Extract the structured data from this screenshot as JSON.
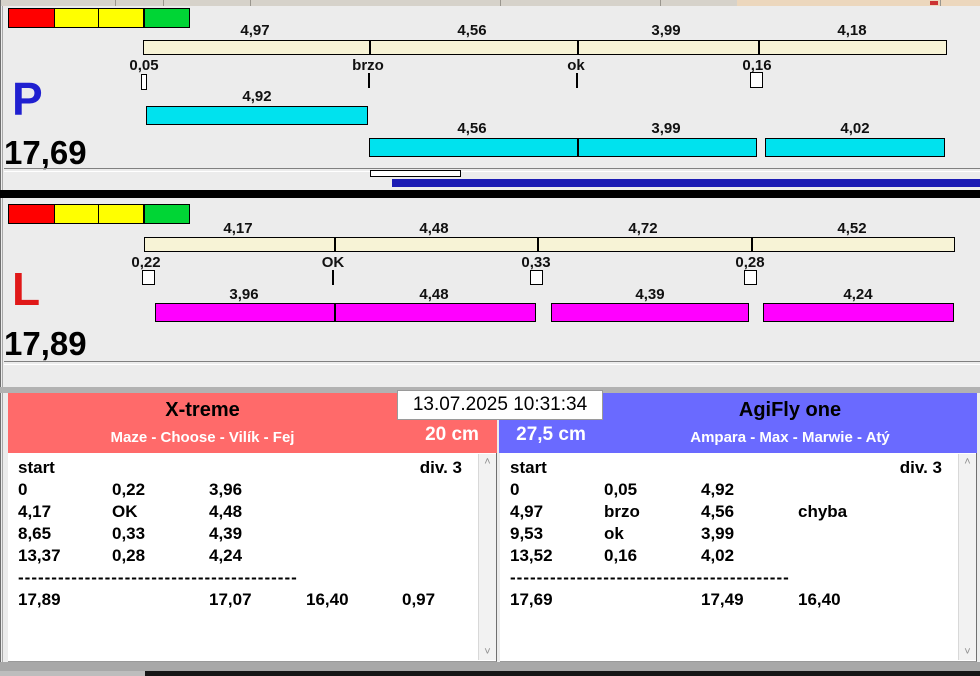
{
  "app": {
    "datetime": "13.07.2025 10:31:34",
    "colors": {
      "salmon_header": "#ff6a6a",
      "blue_header": "#6a6aff",
      "cream_bar": "#f7f3d6",
      "cyan_bar": "#00e2ee",
      "magenta_bar": "#ff00ff",
      "navy_progress": "#1c1cb4",
      "light_red": "#ff0000",
      "light_yellow": "#ffff00",
      "light_green": "#00d535",
      "panel_bg": "#ececec"
    },
    "icons": {
      "scroll_up": "˄",
      "scroll_down": "˅"
    }
  },
  "panel_p": {
    "label": "P",
    "total": "17,69",
    "lights": [
      "red",
      "yellow",
      "yellow",
      "green"
    ],
    "splits": [
      "4,97",
      "4,56",
      "3,99",
      "4,18"
    ],
    "marks": [
      "0,05",
      "brzo",
      "ok",
      "0,16"
    ],
    "runs": [
      "4,92",
      "4,56",
      "3,99",
      "4,02"
    ]
  },
  "panel_l": {
    "label": "L",
    "total": "17,89",
    "lights": [
      "red",
      "yellow",
      "yellow",
      "green"
    ],
    "splits": [
      "4,17",
      "4,48",
      "4,72",
      "4,52"
    ],
    "marks": [
      "0,22",
      "OK",
      "0,33",
      "0,28"
    ],
    "runs": [
      "3,96",
      "4,48",
      "4,39",
      "4,24"
    ]
  },
  "teams": {
    "left": {
      "name": "X-treme",
      "members": "Maze - Choose - Vilík - Fej",
      "jump_height": "20 cm",
      "col_header": "start",
      "div_label": "div. 3",
      "rows": [
        [
          "0",
          "0,22",
          "3,96",
          ""
        ],
        [
          "4,17",
          "OK",
          "4,48",
          ""
        ],
        [
          "8,65",
          "0,33",
          "4,39",
          ""
        ],
        [
          "13,37",
          "0,28",
          "4,24",
          ""
        ]
      ],
      "separator": "------------------------------------------------",
      "totals": [
        "17,89",
        "",
        "17,07",
        "16,40",
        "0,97"
      ]
    },
    "right": {
      "name": "AgiFly one",
      "members": "Ampara - Max - Marwie - Atý",
      "jump_height": "27,5 cm",
      "col_header": "start",
      "div_label": "div. 3",
      "rows": [
        [
          "0",
          "0,05",
          "4,92",
          ""
        ],
        [
          "4,97",
          "brzo",
          "4,56",
          "chyba"
        ],
        [
          "9,53",
          "ok",
          "3,99",
          ""
        ],
        [
          "13,52",
          "0,16",
          "4,02",
          ""
        ]
      ],
      "separator": "------------------------------------------------",
      "totals": [
        "17,69",
        "",
        "17,49",
        "16,40",
        ""
      ]
    }
  }
}
